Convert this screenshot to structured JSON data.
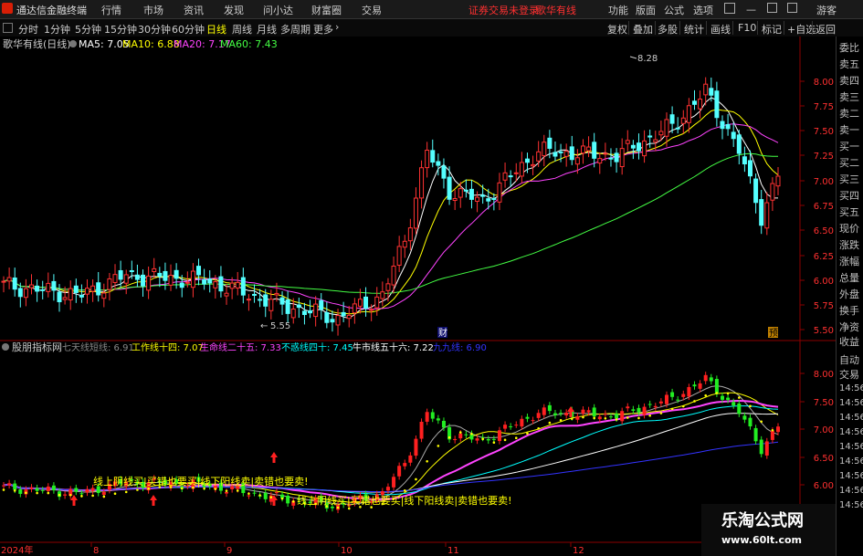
{
  "menubar": {
    "app_title": "通达信金融终端",
    "menus": [
      "行情",
      "市场",
      "资讯",
      "发现",
      "问小达",
      "财富圈",
      "交易"
    ],
    "notice": "证券交易未登录",
    "stock_name": "歌华有线",
    "right_menus": [
      "功能",
      "版面",
      "公式",
      "选项"
    ],
    "user": "游客"
  },
  "toolbar": {
    "periods": [
      "分时",
      "1分钟",
      "5分钟",
      "15分钟",
      "30分钟",
      "60分钟",
      "日线",
      "周线",
      "月线",
      "多周期",
      "更多"
    ],
    "active_period": "日线",
    "right_buttons": [
      "复权",
      "叠加",
      "多股",
      "统计",
      "画线",
      "F10",
      "标记",
      "+自选",
      "返回"
    ]
  },
  "main_chart": {
    "title": "歌华有线(日线)",
    "ma_labels": [
      {
        "text": "MA5: 7.05",
        "color": "#ffffff"
      },
      {
        "text": "MA10: 6.88",
        "color": "#ffff00"
      },
      {
        "text": "MA20: 7.17",
        "color": "#ff44ff"
      },
      {
        "text": "MA60: 7.43",
        "color": "#44ff44"
      }
    ],
    "y_ticks": [
      "8.00",
      "7.75",
      "7.50",
      "7.25",
      "7.00",
      "6.75",
      "6.50",
      "6.25",
      "6.00",
      "5.75",
      "5.50"
    ],
    "high_label": "8.28",
    "low_label": "5.55",
    "markers": [
      "财",
      "预"
    ]
  },
  "sub_chart": {
    "title": "股朋指标网",
    "lines": [
      {
        "text": "七天线短线: 6.91",
        "color": "#888888"
      },
      {
        "text": "工作线十四: 7.07",
        "color": "#ffff00"
      },
      {
        "text": "生命线二十五: 7.33",
        "color": "#ff44ff"
      },
      {
        "text": "不惑线四十: 7.45",
        "color": "#00ffff"
      },
      {
        "text": "牛市线五十六: 7.22",
        "color": "#ffffff"
      },
      {
        "text": "九九线: 6.90",
        "color": "#3333ff"
      }
    ],
    "y_ticks": [
      "8.00",
      "7.50",
      "7.00",
      "6.50",
      "6.00"
    ],
    "annotation_1": "线上阴线买|买错也要买|线下阳线卖|卖错也要卖!",
    "annotation_2": "线上阴线买|买错也要买|线下阳线卖|卖错也要卖!"
  },
  "x_axis": {
    "labels": [
      "2024年",
      "8",
      "9",
      "10",
      "11",
      "12"
    ]
  },
  "right_panel": {
    "top_items": [
      "委比",
      "卖五",
      "卖四",
      "卖三",
      "卖二",
      "卖一",
      "买一",
      "买二",
      "买三",
      "买四",
      "买五",
      "现价",
      "涨跌",
      "涨幅",
      "总量",
      "外盘",
      "换手",
      "净资",
      "收益"
    ],
    "bottom_items": [
      "自动",
      "交易",
      "14:56",
      "14:56",
      "14:56",
      "14:56",
      "14:56",
      "14:56",
      "14:56",
      "14:56",
      "14:56"
    ]
  },
  "watermark": {
    "title": "乐淘公式网",
    "url": "www.60lt.com"
  },
  "colors": {
    "up": "#ff3232",
    "down": "#54ffff",
    "accent_red": "#ff2020",
    "ma5": "#ffffff",
    "ma10": "#ffff00",
    "ma20": "#ff44ff",
    "ma60": "#44ff44",
    "sub_up": "#ff2020",
    "sub_down": "#22ee22"
  },
  "chart_data": {
    "type": "candlestick",
    "title": "歌华有线(日线)",
    "ylim": [
      5.5,
      8.3
    ],
    "high": 8.28,
    "low": 5.55,
    "ma": {
      "MA5": 7.05,
      "MA10": 6.88,
      "MA20": 7.17,
      "MA60": 7.43
    },
    "x_labels": [
      "2024年",
      "8",
      "9",
      "10",
      "11",
      "12"
    ]
  }
}
